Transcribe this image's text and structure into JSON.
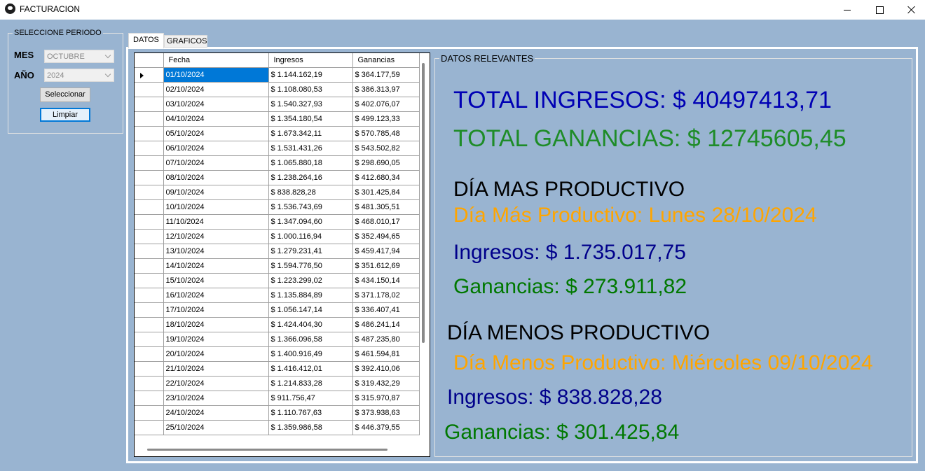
{
  "window": {
    "title": "FACTURACION"
  },
  "period": {
    "legend": "SELECCIONE PERIODO",
    "mes_label": "MES",
    "mes_value": "OCTUBRE",
    "anio_label": "AÑO",
    "anio_value": "2024",
    "select_button": "Seleccionar",
    "clear_button": "Limpiar"
  },
  "tabs": [
    {
      "label": "DATOS"
    },
    {
      "label": "GRAFICOS"
    }
  ],
  "table": {
    "columns": [
      "Fecha",
      "Ingresos",
      "Ganancias"
    ],
    "rows": [
      [
        "01/10/2024",
        "$ 1.144.162,19",
        "$ 364.177,59"
      ],
      [
        "02/10/2024",
        "$ 1.108.080,53",
        "$ 386.313,97"
      ],
      [
        "03/10/2024",
        "$ 1.540.327,93",
        "$ 402.076,07"
      ],
      [
        "04/10/2024",
        "$ 1.354.180,54",
        "$ 499.123,33"
      ],
      [
        "05/10/2024",
        "$ 1.673.342,11",
        "$ 570.785,48"
      ],
      [
        "06/10/2024",
        "$ 1.531.431,26",
        "$ 543.502,82"
      ],
      [
        "07/10/2024",
        "$ 1.065.880,18",
        "$ 298.690,05"
      ],
      [
        "08/10/2024",
        "$ 1.238.264,16",
        "$ 412.680,34"
      ],
      [
        "09/10/2024",
        "$ 838.828,28",
        "$ 301.425,84"
      ],
      [
        "10/10/2024",
        "$ 1.536.743,69",
        "$ 481.305,51"
      ],
      [
        "11/10/2024",
        "$ 1.347.094,60",
        "$ 468.010,17"
      ],
      [
        "12/10/2024",
        "$ 1.000.116,94",
        "$ 352.494,65"
      ],
      [
        "13/10/2024",
        "$ 1.279.231,41",
        "$ 459.417,94"
      ],
      [
        "14/10/2024",
        "$ 1.594.776,50",
        "$ 351.612,69"
      ],
      [
        "15/10/2024",
        "$ 1.223.299,02",
        "$ 434.150,14"
      ],
      [
        "16/10/2024",
        "$ 1.135.884,89",
        "$ 371.178,02"
      ],
      [
        "17/10/2024",
        "$ 1.056.147,14",
        "$ 336.407,41"
      ],
      [
        "18/10/2024",
        "$ 1.424.404,30",
        "$ 486.241,14"
      ],
      [
        "19/10/2024",
        "$ 1.366.096,58",
        "$ 487.235,80"
      ],
      [
        "20/10/2024",
        "$ 1.400.916,49",
        "$ 461.594,81"
      ],
      [
        "21/10/2024",
        "$ 1.416.412,01",
        "$ 392.410,06"
      ],
      [
        "22/10/2024",
        "$ 1.214.833,28",
        "$ 319.432,29"
      ],
      [
        "23/10/2024",
        "$ 911.756,47",
        "$ 315.970,87"
      ],
      [
        "24/10/2024",
        "$ 1.110.767,63",
        "$ 373.938,63"
      ],
      [
        "25/10/2024",
        "$ 1.359.986,58",
        "$ 446.379,55"
      ]
    ]
  },
  "relevant": {
    "legend": "DATOS RELEVANTES",
    "total_ingresos": "TOTAL INGRESOS: $ 40497413,71",
    "total_ganancias": "TOTAL GANANCIAS: $ 12745605,45",
    "best_heading": "DÍA MAS PRODUCTIVO",
    "best_day": "Día Más Productivo: Lunes 28/10/2024",
    "best_ingresos": "Ingresos: $ 1.735.017,75",
    "best_ganancias": "Ganancias: $ 273.911,82",
    "worst_heading": "DÍA MENOS PRODUCTIVO",
    "worst_day": "Día Menos Productivo: Miércoles 09/10/2024",
    "worst_ingresos": "Ingresos: $ 838.828,28",
    "worst_ganancias": "Ganancias: $ 301.425,84"
  },
  "colors": {
    "background": "#99b4d1",
    "selection": "#0078d7",
    "total_ingresos": "#0000b4",
    "total_ganancias": "#1e8c28",
    "day_label": "#ffa500"
  }
}
